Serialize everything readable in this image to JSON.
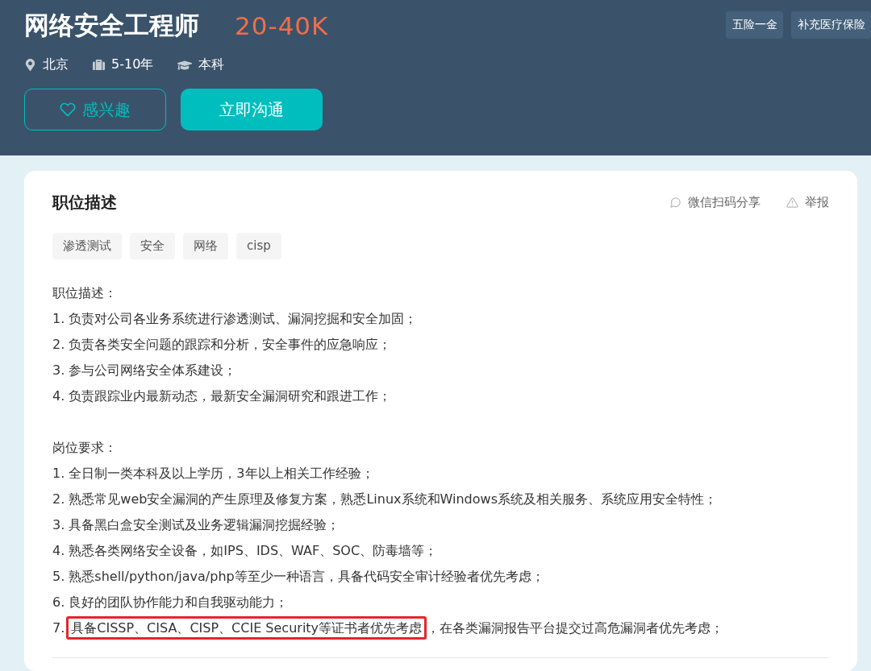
{
  "job": {
    "title": "网络安全工程师",
    "salary": "20-40K",
    "meta": [
      {
        "kind": "location",
        "text": "北京"
      },
      {
        "kind": "experience",
        "text": "5-10年"
      },
      {
        "kind": "education",
        "text": "本科"
      }
    ],
    "benefits": [
      "五险一金",
      "补充医疗保险"
    ],
    "buttons": [
      {
        "kind": "outline",
        "label": "感兴趣"
      },
      {
        "kind": "primary",
        "label": "立即沟通"
      }
    ]
  },
  "description": {
    "title": "职位描述",
    "actions": [
      {
        "kind": "share",
        "label": "微信扫码分享"
      },
      {
        "kind": "report",
        "label": "举报"
      }
    ],
    "tags": [
      "渗透测试",
      "安全",
      "网络",
      "cisp"
    ],
    "sections": [
      {
        "lines": [
          {
            "text": "职位描述："
          },
          {
            "text": "1. 负责对公司各业务系统进行渗透测试、漏洞挖掘和安全加固；"
          },
          {
            "text": "2. 负责各类安全问题的跟踪和分析，安全事件的应急响应；"
          },
          {
            "text": "3. 参与公司网络安全体系建设；"
          },
          {
            "text": "4. 负责跟踪业内最新动态，最新安全漏洞研究和跟进工作；"
          }
        ]
      },
      {
        "lines": [
          {
            "text": "岗位要求："
          },
          {
            "text": "1. 全日制一类本科及以上学历，3年以上相关工作经验；"
          },
          {
            "text": "2. 熟悉常见web安全漏洞的产生原理及修复方案，熟悉Linux系统和Windows系统及相关服务、系统应用安全特性；"
          },
          {
            "text": "3. 具备黑白盒安全测试及业务逻辑漏洞挖掘经验；"
          },
          {
            "text": "4. 熟悉各类网络安全设备，如IPS、IDS、WAF、SOC、防毒墙等；"
          },
          {
            "text": "5. 熟悉shell/python/java/php等至少一种语言，具备代码安全审计经验者优先考虑；"
          },
          {
            "text": "6. 良好的团队协作能力和自我驱动能力；"
          },
          {
            "text": "7.",
            "highlight": "具备CISSP、CISA、CISP、CCIE Security等证书者优先考虑",
            "rest": "，在各类漏洞报告平台提交过高危漏洞者优先考虑；"
          }
        ]
      }
    ]
  }
}
